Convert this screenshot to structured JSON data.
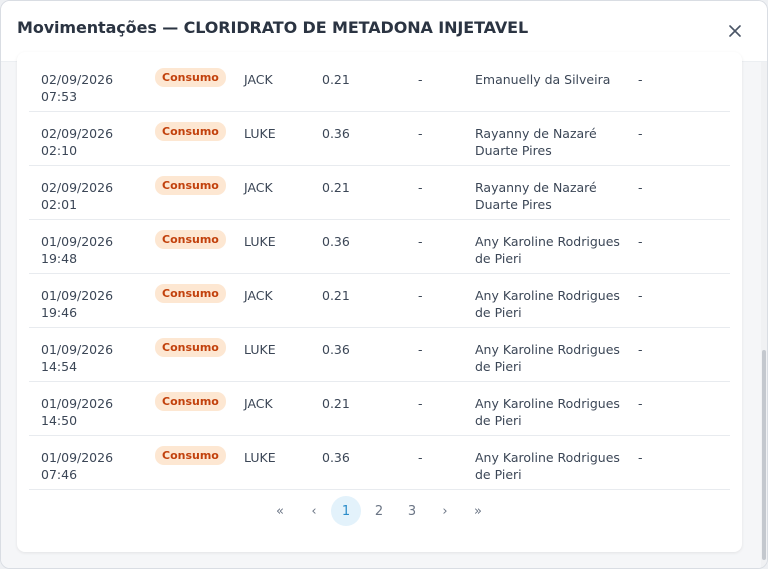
{
  "modal": {
    "title": "Movimentações — CLORIDRATO DE METADONA INJETAVEL"
  },
  "rows": [
    {
      "date": "02/09/2026",
      "time": "07:53",
      "type": "Consumo",
      "by": "JACK",
      "qty": "0.21",
      "lot": "-",
      "user1": "Emanuelly da Silveira",
      "user2": "",
      "obs": "-"
    },
    {
      "date": "02/09/2026",
      "time": "02:10",
      "type": "Consumo",
      "by": "LUKE",
      "qty": "0.36",
      "lot": "-",
      "user1": "Rayanny de Nazaré",
      "user2": "Duarte Pires",
      "obs": "-"
    },
    {
      "date": "02/09/2026",
      "time": "02:01",
      "type": "Consumo",
      "by": "JACK",
      "qty": "0.21",
      "lot": "-",
      "user1": "Rayanny de Nazaré",
      "user2": "Duarte Pires",
      "obs": "-"
    },
    {
      "date": "01/09/2026",
      "time": "19:48",
      "type": "Consumo",
      "by": "LUKE",
      "qty": "0.36",
      "lot": "-",
      "user1": "Any Karoline Rodrigues",
      "user2": "de Pieri",
      "obs": "-"
    },
    {
      "date": "01/09/2026",
      "time": "19:46",
      "type": "Consumo",
      "by": "JACK",
      "qty": "0.21",
      "lot": "-",
      "user1": "Any Karoline Rodrigues",
      "user2": "de Pieri",
      "obs": "-"
    },
    {
      "date": "01/09/2026",
      "time": "14:54",
      "type": "Consumo",
      "by": "LUKE",
      "qty": "0.36",
      "lot": "-",
      "user1": "Any Karoline Rodrigues",
      "user2": "de Pieri",
      "obs": "-"
    },
    {
      "date": "01/09/2026",
      "time": "14:50",
      "type": "Consumo",
      "by": "JACK",
      "qty": "0.21",
      "lot": "-",
      "user1": "Any Karoline Rodrigues",
      "user2": "de Pieri",
      "obs": "-"
    },
    {
      "date": "01/09/2026",
      "time": "07:46",
      "type": "Consumo",
      "by": "LUKE",
      "qty": "0.36",
      "lot": "-",
      "user1": "Any Karoline Rodrigues",
      "user2": "de Pieri",
      "obs": "-"
    }
  ],
  "pagination": {
    "first": "«",
    "prev": "‹",
    "pages": [
      "1",
      "2",
      "3"
    ],
    "current": "1",
    "next": "›",
    "last": "»"
  },
  "colors": {
    "badge_bg": "#fde7d2",
    "badge_text": "#c2410c",
    "active_page_bg": "#e3f2fb",
    "active_page_text": "#2a8cc9"
  }
}
